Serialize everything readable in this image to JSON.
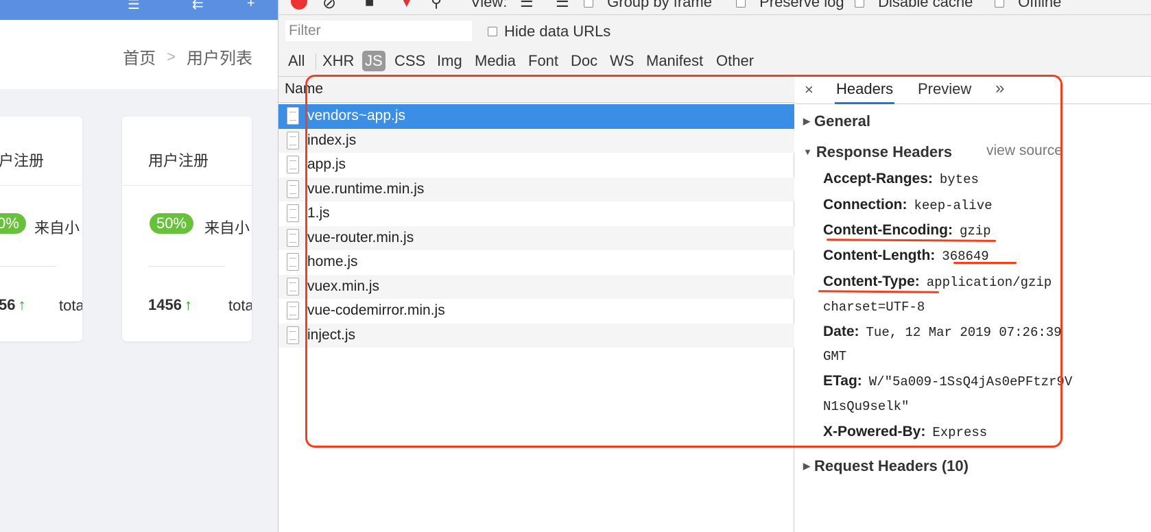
{
  "app": {
    "breadcrumb": {
      "home": "首页",
      "separator": ">",
      "current": "用户列表"
    },
    "cards": [
      {
        "title": "户注册",
        "percent": "0%",
        "source": "来自小",
        "count": "56",
        "arrow": "↑",
        "total": "tota"
      },
      {
        "title": "用户注册",
        "percent": "50%",
        "source": "来自小",
        "count": "1456",
        "arrow": "↑",
        "total": "tota"
      }
    ]
  },
  "devtools": {
    "toolbar": {
      "view_label": "View:",
      "group_by_frame": "Group by frame",
      "preserve_log": "Preserve log",
      "disable_cache": "Disable cache",
      "offline": "Offline"
    },
    "filter": {
      "placeholder": "Filter",
      "hide_data_urls": "Hide data URLs"
    },
    "filter_types": [
      "All",
      "XHR",
      "JS",
      "CSS",
      "Img",
      "Media",
      "Font",
      "Doc",
      "WS",
      "Manifest",
      "Other"
    ],
    "active_filter": "JS",
    "name_column": "Name",
    "requests": [
      "vendors~app.js",
      "index.js",
      "app.js",
      "vue.runtime.min.js",
      "1.js",
      "vue-router.min.js",
      "home.js",
      "vuex.min.js",
      "vue-codemirror.min.js",
      "inject.js"
    ],
    "selected_request": "vendors~app.js",
    "tabs": {
      "close": "×",
      "headers": "Headers",
      "preview": "Preview",
      "more": "»"
    },
    "general_label": "General",
    "response_headers_label": "Response Headers",
    "view_source": "view source",
    "response_headers": {
      "accept_ranges": {
        "key": "Accept-Ranges:",
        "value": "bytes"
      },
      "connection": {
        "key": "Connection:",
        "value": "keep-alive"
      },
      "content_encoding": {
        "key": "Content-Encoding:",
        "value": "gzip"
      },
      "content_length": {
        "key": "Content-Length:",
        "value": "368649"
      },
      "content_type": {
        "key": "Content-Type:",
        "value": "application/gzip",
        "value_cont": "charset=UTF-8"
      },
      "date": {
        "key": "Date:",
        "value": "Tue, 12 Mar 2019 07:26:39",
        "value_cont": "GMT"
      },
      "etag": {
        "key": "ETag:",
        "value": "W/\"5a009-1SsQ4jAs0ePFtzr9V",
        "value_cont": "N1sQu9selk\""
      },
      "x_powered_by": {
        "key": "X-Powered-By:",
        "value": "Express"
      }
    },
    "request_headers_label": "Request Headers (10)"
  },
  "colors": {
    "annotation": "#f0401f",
    "selection": "#3a8ee6",
    "badge": "#67c23a",
    "app_bar": "#5b8fe0"
  }
}
